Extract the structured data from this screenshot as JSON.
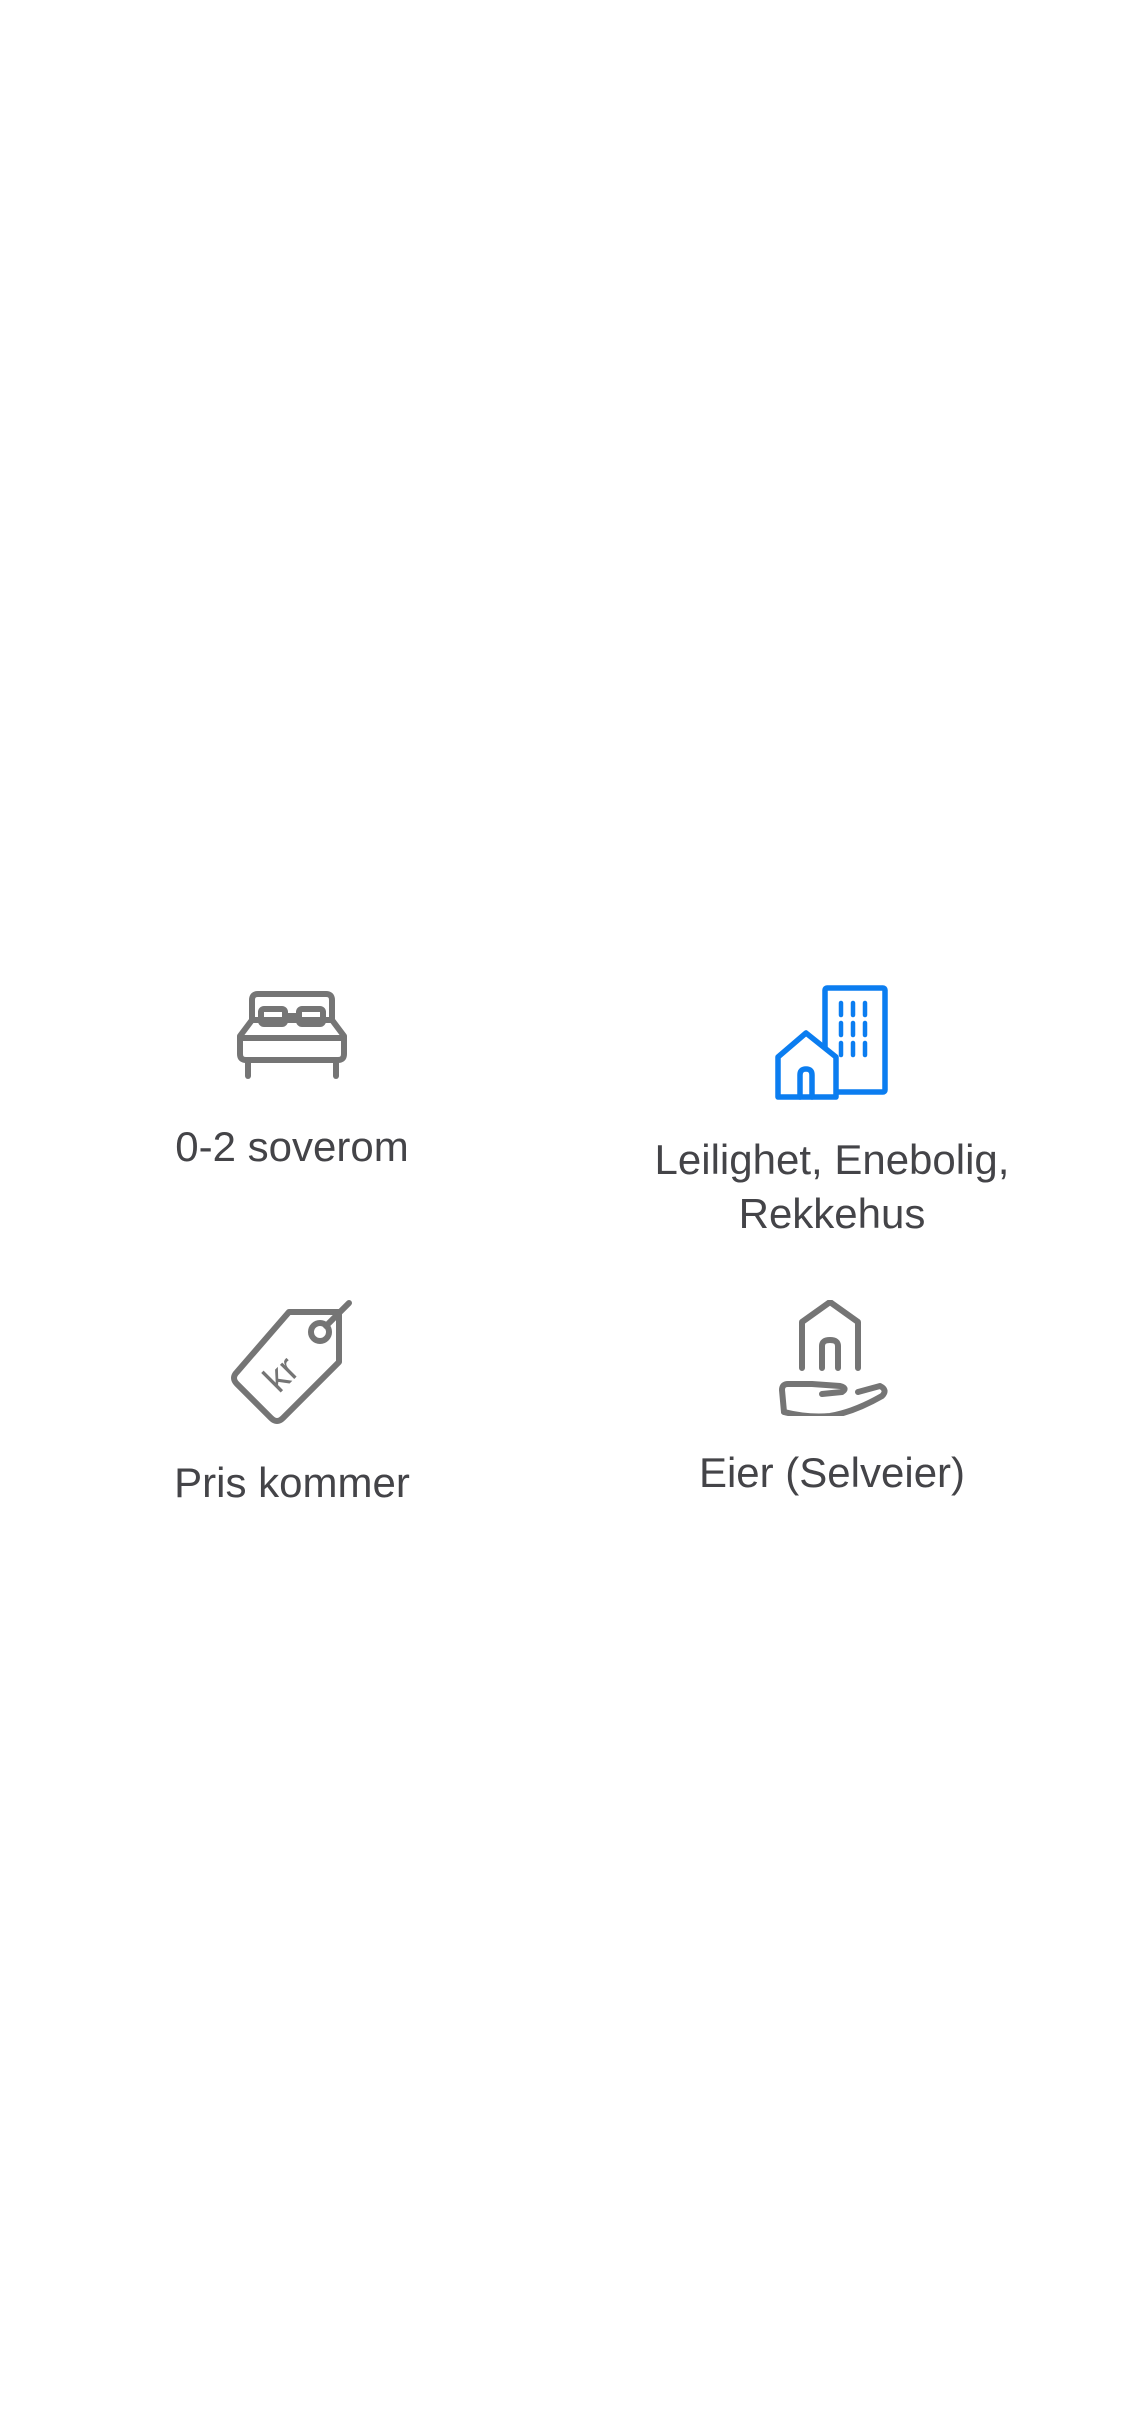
{
  "colors": {
    "icon_gray": "#757575",
    "icon_blue": "#0b7df0",
    "label_text": "#444448",
    "background": "#ffffff"
  },
  "features": {
    "bedrooms": {
      "icon": "bed-icon",
      "label": "0-2 soverom"
    },
    "property_type": {
      "icon": "buildings-icon",
      "label": "Leilighet, Enebolig,\nRekkehus"
    },
    "price": {
      "icon": "price-tag-icon",
      "label": "Pris kommer",
      "tag_text": "kr"
    },
    "ownership": {
      "icon": "house-in-hand-icon",
      "label": "Eier (Selveier)"
    }
  }
}
